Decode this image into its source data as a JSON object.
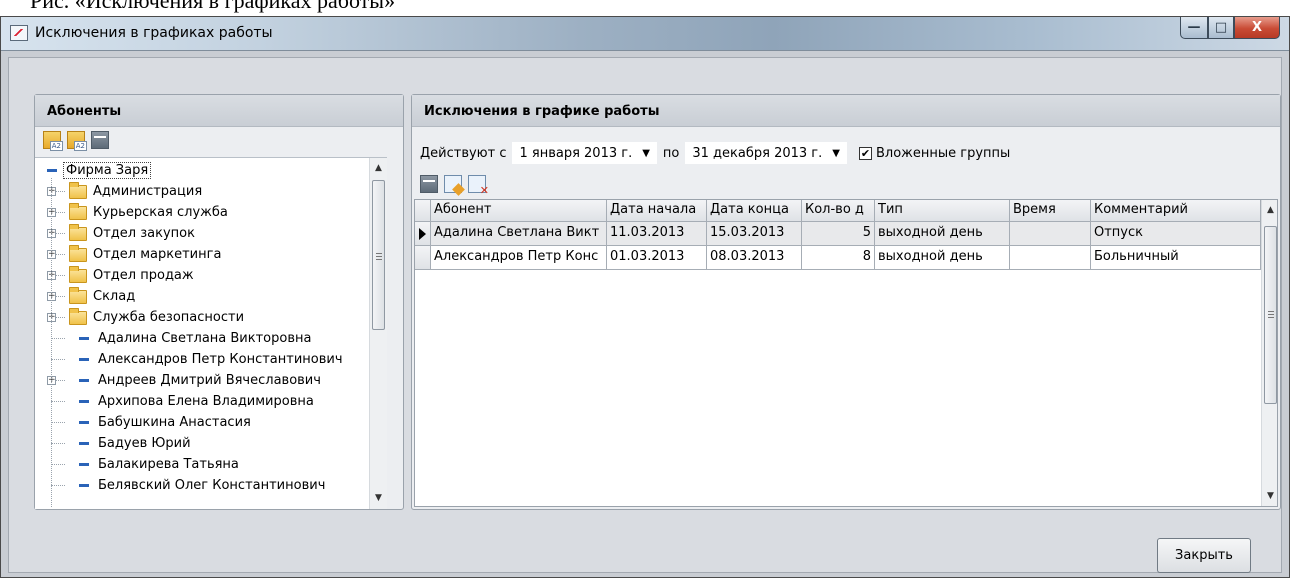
{
  "caption_text": "Рис. «Исключения в графиках работы»",
  "window": {
    "title": "Исключения в графиках работы",
    "min_symbol": "—",
    "max_symbol": "□",
    "close_symbol": "X"
  },
  "left_panel": {
    "title": "Абоненты",
    "toolbar": [
      "expand-tree-icon",
      "collapse-tree-icon",
      "select-icon"
    ],
    "root": {
      "expander": "−",
      "label": "Фирма Заря"
    },
    "items": [
      {
        "type": "folder",
        "expandable": true,
        "label": "Администрация"
      },
      {
        "type": "folder",
        "expandable": true,
        "label": "Курьерская служба"
      },
      {
        "type": "folder",
        "expandable": true,
        "label": "Отдел закупок"
      },
      {
        "type": "folder",
        "expandable": true,
        "label": "Отдел маркетинга"
      },
      {
        "type": "folder",
        "expandable": true,
        "label": "Отдел продаж"
      },
      {
        "type": "folder",
        "expandable": true,
        "label": "Склад"
      },
      {
        "type": "folder",
        "expandable": true,
        "label": "Служба безопасности"
      },
      {
        "type": "person",
        "expandable": false,
        "label": "Адалина Светлана Викторовна"
      },
      {
        "type": "person",
        "expandable": false,
        "label": "Александров Петр Константинович"
      },
      {
        "type": "person",
        "expandable": true,
        "label": "Андреев Дмитрий Вячеславович"
      },
      {
        "type": "person",
        "expandable": false,
        "label": "Архипова Елена Владимировна"
      },
      {
        "type": "person",
        "expandable": false,
        "label": "Бабушкина Анастасия"
      },
      {
        "type": "person",
        "expandable": false,
        "label": "Бадуев Юрий"
      },
      {
        "type": "person",
        "expandable": false,
        "label": "Балакирева Татьяна"
      },
      {
        "type": "person",
        "expandable": false,
        "label": "Белявский Олег Константинович"
      }
    ]
  },
  "right_panel": {
    "title": "Исключения в графике работы",
    "filter": {
      "label_from": "Действуют с",
      "date_from": "1  января  2013 г.",
      "label_to": "по",
      "date_to": "31 декабря 2013 г.",
      "dropdown_symbol": "▼",
      "nested_checked_symbol": "✔",
      "nested_label": "Вложенные группы"
    },
    "toolbar": [
      "add-icon",
      "edit-icon",
      "delete-icon"
    ],
    "columns": [
      "Абонент",
      "Дата начала",
      "Дата конца",
      "Кол-во д",
      "Тип",
      "Время",
      "Комментарий"
    ],
    "rows": [
      {
        "subscriber": "Адалина Светлана Викт",
        "start": "11.03.2013",
        "end": "15.03.2013",
        "days": "5",
        "type": "выходной день",
        "time": "",
        "comment": "Отпуск"
      },
      {
        "subscriber": "Александров Петр Конс",
        "start": "01.03.2013",
        "end": "08.03.2013",
        "days": "8",
        "type": "выходной день",
        "time": "",
        "comment": "Больничный"
      }
    ]
  },
  "close_button_label": "Закрыть",
  "colors": {
    "accent": "#2a63b8",
    "close_red": "#c94b35",
    "folder": "#f0c24a"
  }
}
